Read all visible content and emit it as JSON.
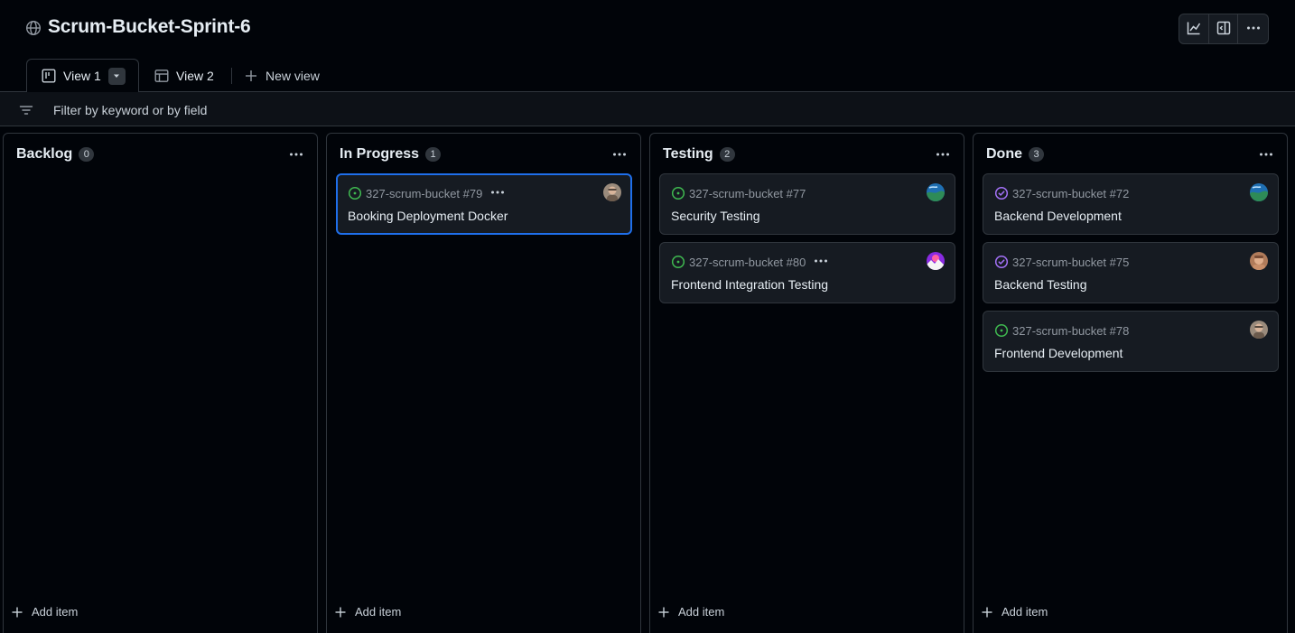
{
  "project": {
    "title": "Scrum-Bucket-Sprint-6"
  },
  "tabs": {
    "view1": "View 1",
    "view2": "View 2",
    "new_view": "New view"
  },
  "filter": {
    "placeholder": "Filter by keyword or by field"
  },
  "add_item_label": "Add item",
  "columns": [
    {
      "title": "Backlog",
      "count": "0",
      "cards": []
    },
    {
      "title": "In Progress",
      "count": "1",
      "cards": [
        {
          "ref": "327-scrum-bucket #79",
          "title": "Booking Deployment Docker",
          "status": "open",
          "selected": true,
          "avatar": "avatar-photo-1"
        }
      ]
    },
    {
      "title": "Testing",
      "count": "2",
      "cards": [
        {
          "ref": "327-scrum-bucket #77",
          "title": "Security Testing",
          "status": "open",
          "avatar": "avatar-earth"
        },
        {
          "ref": "327-scrum-bucket #80",
          "title": "Frontend Integration Testing",
          "status": "open",
          "avatar": "avatar-sunset"
        }
      ]
    },
    {
      "title": "Done",
      "count": "3",
      "cards": [
        {
          "ref": "327-scrum-bucket #72",
          "title": "Backend Development",
          "status": "closed",
          "avatar": "avatar-earth"
        },
        {
          "ref": "327-scrum-bucket #75",
          "title": "Backend Testing",
          "status": "closed",
          "avatar": "avatar-photo-2"
        },
        {
          "ref": "327-scrum-bucket #78",
          "title": "Frontend Development",
          "status": "open",
          "avatar": "avatar-photo-1"
        }
      ]
    }
  ],
  "colors": {
    "open": "#3fb950",
    "closed": "#a371f7",
    "selected_border": "#1f6feb"
  }
}
